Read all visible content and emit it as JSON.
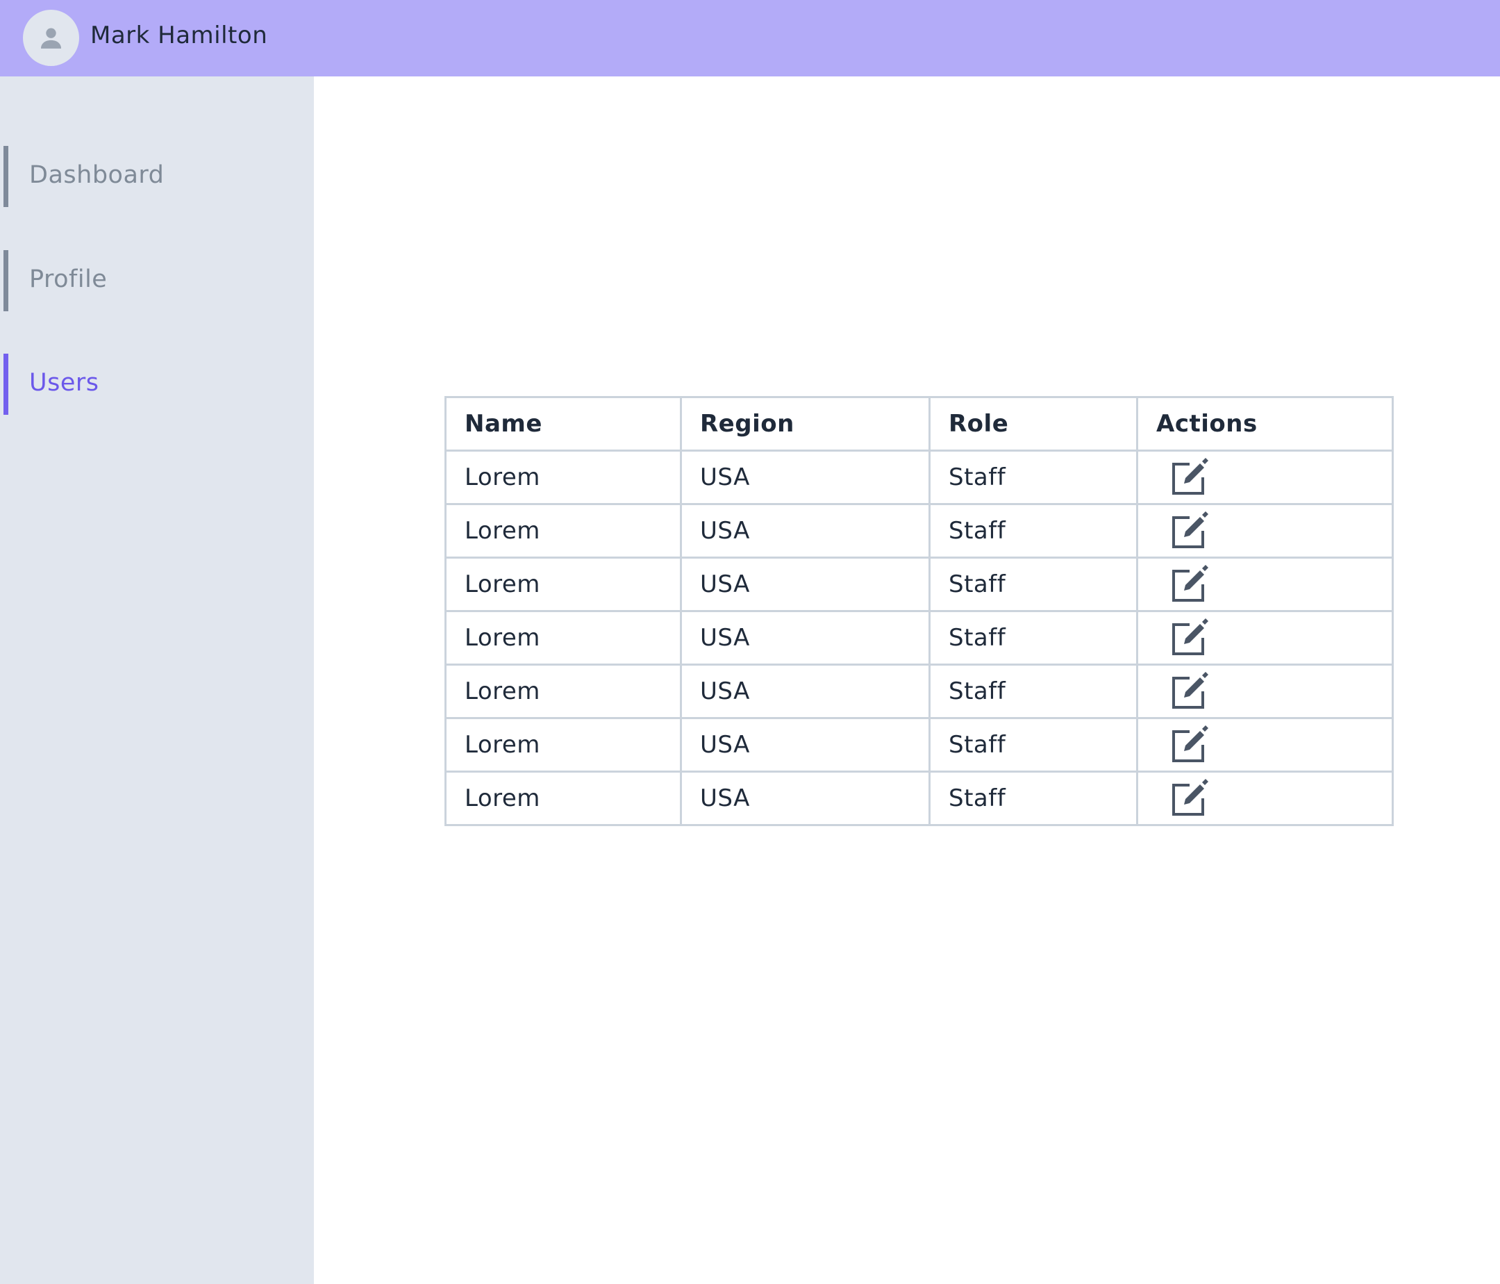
{
  "header": {
    "user_name": "Mark Hamilton"
  },
  "sidebar": {
    "items": [
      {
        "label": "Dashboard",
        "active": false
      },
      {
        "label": "Profile",
        "active": false
      },
      {
        "label": "Users",
        "active": true
      }
    ]
  },
  "table": {
    "headers": [
      "Name",
      "Region",
      "Role",
      "Actions"
    ],
    "rows": [
      {
        "name": "Lorem",
        "region": "USA",
        "role": "Staff",
        "action_icon": "edit-icon"
      },
      {
        "name": "Lorem",
        "region": "USA",
        "role": "Staff",
        "action_icon": "edit-icon"
      },
      {
        "name": "Lorem",
        "region": "USA",
        "role": "Staff",
        "action_icon": "edit-icon"
      },
      {
        "name": "Lorem",
        "region": "USA",
        "role": "Staff",
        "action_icon": "edit-icon"
      },
      {
        "name": "Lorem",
        "region": "USA",
        "role": "Staff",
        "action_icon": "edit-icon"
      },
      {
        "name": "Lorem",
        "region": "USA",
        "role": "Staff",
        "action_icon": "edit-icon"
      },
      {
        "name": "Lorem",
        "region": "USA",
        "role": "Staff",
        "action_icon": "edit-icon"
      }
    ]
  },
  "colors": {
    "header_bg": "#b3abf8",
    "sidebar_bg": "#e1e6ee",
    "accent": "#7360ee",
    "inactive_nav": "#7f8a9a",
    "text": "#1f2a3a",
    "table_border": "#cbd3dc",
    "icon": "#4a5565"
  }
}
